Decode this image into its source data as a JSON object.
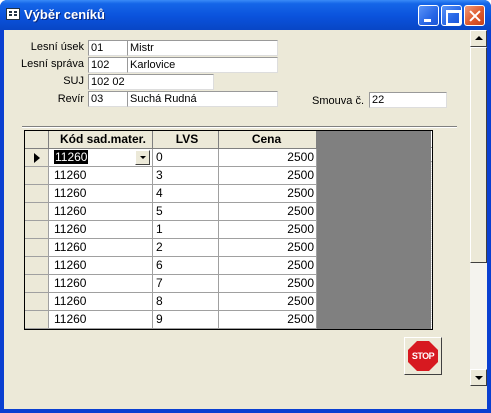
{
  "window": {
    "title": "Výběr ceníků"
  },
  "form": {
    "lesni_usek": {
      "label": "Lesní úsek",
      "code": "01",
      "name": "Mistr"
    },
    "lesni_sprava": {
      "label": "Lesní správa",
      "code": "102",
      "name": "Karlovice"
    },
    "suj": {
      "label": "SUJ",
      "value": "102 02"
    },
    "revir": {
      "label": "Revír",
      "code": "03",
      "name": "Suchá Rudná"
    },
    "smouva": {
      "label": "Smouva č.",
      "value": "22"
    }
  },
  "grid": {
    "columns": [
      "Kód sad.mater.",
      "LVS",
      "Cena"
    ],
    "rows": [
      {
        "kod": "11260",
        "lvs": "0",
        "cena": "2500",
        "current": true
      },
      {
        "kod": "11260",
        "lvs": "3",
        "cena": "2500"
      },
      {
        "kod": "11260",
        "lvs": "4",
        "cena": "2500"
      },
      {
        "kod": "11260",
        "lvs": "5",
        "cena": "2500"
      },
      {
        "kod": "11260",
        "lvs": "1",
        "cena": "2500"
      },
      {
        "kod": "11260",
        "lvs": "2",
        "cena": "2500"
      },
      {
        "kod": "11260",
        "lvs": "6",
        "cena": "2500"
      },
      {
        "kod": "11260",
        "lvs": "7",
        "cena": "2500"
      },
      {
        "kod": "11260",
        "lvs": "8",
        "cena": "2500"
      },
      {
        "kod": "11260",
        "lvs": "9",
        "cena": "2500"
      }
    ]
  },
  "stop_button": {
    "label": "STOP",
    "color": "#d71920"
  }
}
